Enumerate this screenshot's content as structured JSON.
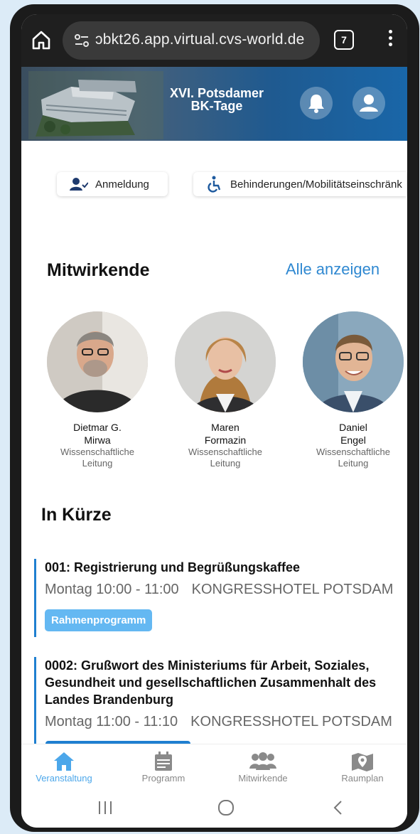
{
  "browser": {
    "url": "ɔbkt26.app.virtual.cvs-world.de",
    "tab_count": "7"
  },
  "hero": {
    "title_line1": "XVI. Potsdamer",
    "title_line2": "BK-Tage"
  },
  "chips": [
    {
      "label": "Anmeldung",
      "icon": "user-check-icon"
    },
    {
      "label": "Behinderungen/Mobilitätseinschränk",
      "icon": "wheelchair-icon"
    }
  ],
  "contributors": {
    "title": "Mitwirkende",
    "show_all": "Alle anzeigen",
    "people": [
      {
        "first": "Dietmar G.",
        "last": "Mirwa",
        "role": "Wissenschaftliche Leitung"
      },
      {
        "first": "Maren",
        "last": "Formazin",
        "role": "Wissenschaftliche Leitung"
      },
      {
        "first": "Daniel",
        "last": "Engel",
        "role": "Wissenschaftliche Leitung"
      }
    ]
  },
  "brief": {
    "title": "In Kürze",
    "events": [
      {
        "title": "001: Registrierung und Begrüßungskaffee",
        "time": "Montag 10:00 - 11:00",
        "location": "KONGRESSHOTEL POTSDAM",
        "tag": "Rahmenprogramm"
      },
      {
        "title": "0002: Grußwort des Ministeriums für Arbeit, Soziales, Gesundheit und gesellschaftlichen Zusammenhalt des Landes Brandenburg",
        "time": "Montag 11:00 - 11:10",
        "location": "KONGRESSHOTEL POTSDAM"
      }
    ]
  },
  "nav": [
    {
      "label": "Veranstaltung",
      "icon": "home-icon",
      "active": true
    },
    {
      "label": "Programm",
      "icon": "calendar-icon",
      "active": false
    },
    {
      "label": "Mitwirkende",
      "icon": "people-icon",
      "active": false
    },
    {
      "label": "Raumplan",
      "icon": "map-icon",
      "active": false
    }
  ],
  "colors": {
    "accent": "#2f88d1",
    "nav_active": "#4ca7ea",
    "tag_bg": "#64b8f2",
    "event_border": "#1f7fd0"
  }
}
